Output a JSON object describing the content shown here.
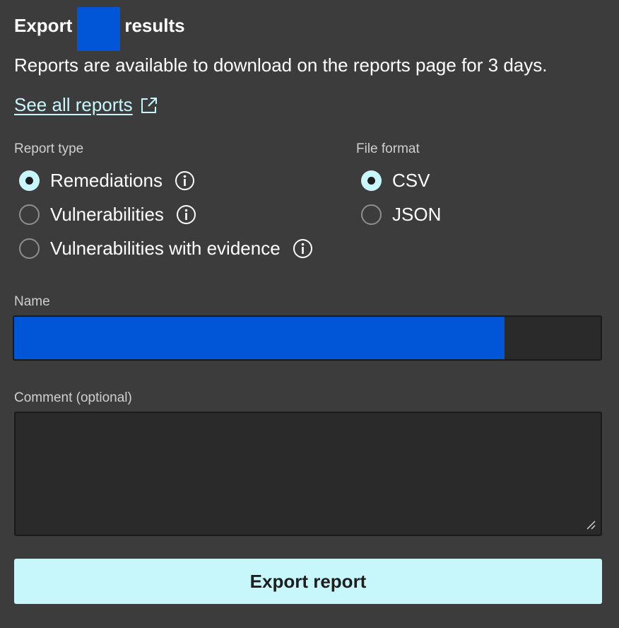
{
  "header": {
    "title_prefix": "Export",
    "title_suffix": "results",
    "redact_color": "#0056d6"
  },
  "description": "Reports are available to download on the reports page for 3 days.",
  "reports_link": {
    "label": "See all reports",
    "icon": "external-link-icon"
  },
  "report_type": {
    "label": "Report type",
    "options": [
      {
        "label": "Remediations",
        "checked": true,
        "icon": "info-icon"
      },
      {
        "label": "Vulnerabilities",
        "checked": false,
        "icon": "info-icon"
      },
      {
        "label": "Vulnerabilities with evidence",
        "checked": false,
        "icon": "info-icon"
      }
    ]
  },
  "file_format": {
    "label": "File format",
    "options": [
      {
        "label": "CSV",
        "checked": true
      },
      {
        "label": "JSON",
        "checked": false
      }
    ]
  },
  "name_field": {
    "label": "Name",
    "value": ""
  },
  "comment_field": {
    "label": "Comment (optional)",
    "value": ""
  },
  "export_button": {
    "label": "Export report"
  },
  "colors": {
    "background": "#3c3c3c",
    "accent": "#c8f7fb",
    "input_background": "#2a2a2a"
  }
}
